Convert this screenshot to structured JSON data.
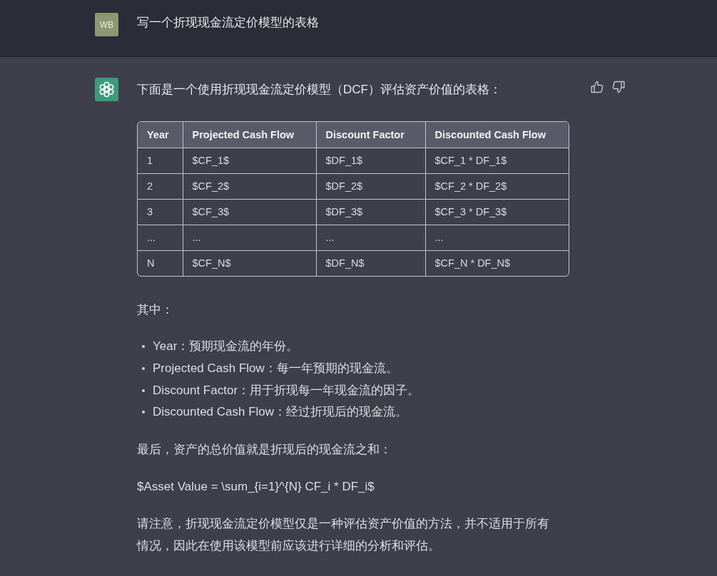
{
  "user_message": {
    "avatar": "WB",
    "text": "写一个折现现金流定价模型的表格"
  },
  "assistant_message": {
    "intro": "下面是一个使用折现现金流定价模型（DCF）评估资产价值的表格：",
    "table": {
      "columns": [
        "Year",
        "Projected Cash Flow",
        "Discount Factor",
        "Discounted Cash Flow"
      ],
      "rows": [
        [
          "1",
          "$CF_1$",
          "$DF_1$",
          "$CF_1 * DF_1$"
        ],
        [
          "2",
          "$CF_2$",
          "$DF_2$",
          "$CF_2 * DF_2$"
        ],
        [
          "3",
          "$CF_3$",
          "$DF_3$",
          "$CF_3 * DF_3$"
        ],
        [
          "...",
          "...",
          "...",
          "..."
        ],
        [
          "N",
          "$CF_N$",
          "$DF_N$",
          "$CF_N * DF_N$"
        ]
      ]
    },
    "where_label": "其中：",
    "bullets": [
      "Year：预期现金流的年份。",
      "Projected Cash Flow：每一年预期的现金流。",
      "Discount Factor：用于折现每一年现金流的因子。",
      "Discounted Cash Flow：经过折现后的现金流。"
    ],
    "summary": "最后，资产的总价值就是折现后的现金流之和：",
    "formula": "$Asset Value = \\sum_{i=1}^{N} CF_i * DF_i$",
    "note": "请注意，折现现金流定价模型仅是一种评估资产价值的方法，并不适用于所有情况，因此在使用该模型前应该进行详细的分析和评估。"
  }
}
